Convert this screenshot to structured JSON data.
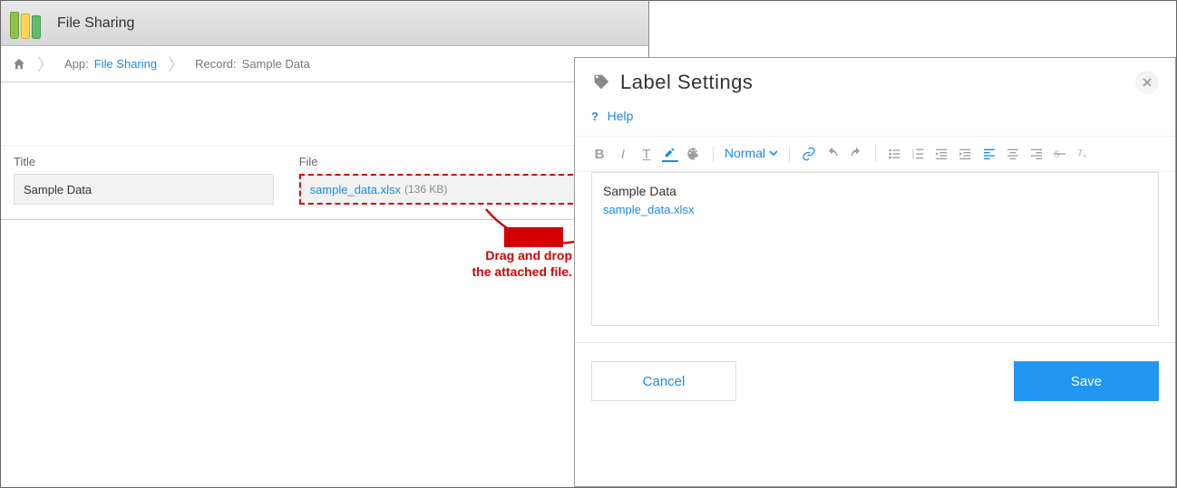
{
  "app": {
    "title": "File Sharing",
    "breadcrumb": {
      "app_prefix": "App:",
      "app_link": "File Sharing",
      "record_prefix": "Record:",
      "record_name": "Sample Data"
    },
    "fields": {
      "title_label": "Title",
      "title_value": "Sample Data",
      "file_label": "File",
      "file_name": "sample_data.xlsx",
      "file_size": "(136 KB)"
    }
  },
  "annotation": {
    "line1": "Drag and drop",
    "line2": "the attached file."
  },
  "dialog": {
    "title": "Label Settings",
    "help": "Help",
    "toolbar": {
      "normal": "Normal"
    },
    "editor": {
      "line1": "Sample Data",
      "file_link": "sample_data.xlsx"
    },
    "buttons": {
      "cancel": "Cancel",
      "save": "Save"
    }
  }
}
